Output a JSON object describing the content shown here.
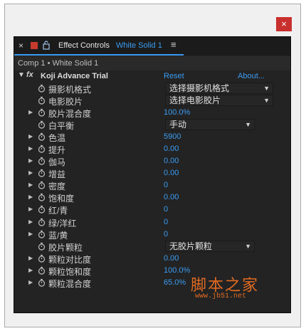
{
  "dialog": {
    "close_glyph": "×"
  },
  "tab": {
    "close_glyph": "×",
    "title": "Effect Controls",
    "target": "White Solid 1",
    "menu_glyph": "≡"
  },
  "breadcrumb": "Comp 1 • White Solid 1",
  "effect": {
    "toggle": "▼",
    "fx": "fx",
    "name": "Koji Advance Trial",
    "reset": "Reset",
    "about": "About..."
  },
  "params": [
    {
      "label": "摄影机格式",
      "expandable": false,
      "dropdown": "选择摄影机格式"
    },
    {
      "label": "电影胶片",
      "expandable": false,
      "dropdown": "选择电影胶片"
    },
    {
      "label": "胶片混合度",
      "expandable": true,
      "value": "100.0%"
    },
    {
      "label": "白平衡",
      "expandable": false,
      "dropdown": "手动",
      "short": true
    },
    {
      "label": "色温",
      "expandable": true,
      "value": "5900"
    },
    {
      "label": "提升",
      "expandable": true,
      "value": "0.00"
    },
    {
      "label": "伽马",
      "expandable": true,
      "value": "0.00"
    },
    {
      "label": "增益",
      "expandable": true,
      "value": "0.00"
    },
    {
      "label": "密度",
      "expandable": true,
      "value": "0"
    },
    {
      "label": "饱和度",
      "expandable": true,
      "value": "0.00"
    },
    {
      "label": "红/青",
      "expandable": true,
      "value": "0"
    },
    {
      "label": "绿/洋红",
      "expandable": true,
      "value": "0"
    },
    {
      "label": "蓝/黄",
      "expandable": true,
      "value": "0"
    },
    {
      "label": "胶片颗粒",
      "expandable": false,
      "dropdown": "无胶片颗粒",
      "short": true
    },
    {
      "label": "颗粒对比度",
      "expandable": true,
      "value": "0.00"
    },
    {
      "label": "颗粒饱和度",
      "expandable": true,
      "value": "100.0%"
    },
    {
      "label": "颗粒混合度",
      "expandable": true,
      "value": "65.0%"
    }
  ],
  "glyphs": {
    "expand": "▶",
    "dropdown_arrow": "▼"
  },
  "watermark": {
    "text": "脚本之家",
    "url": "www.jb51.net"
  },
  "colors": {
    "accent": "#3a9cf2",
    "panel": "#232323",
    "close_red": "#c8302e",
    "watermark": "#e06a22"
  }
}
